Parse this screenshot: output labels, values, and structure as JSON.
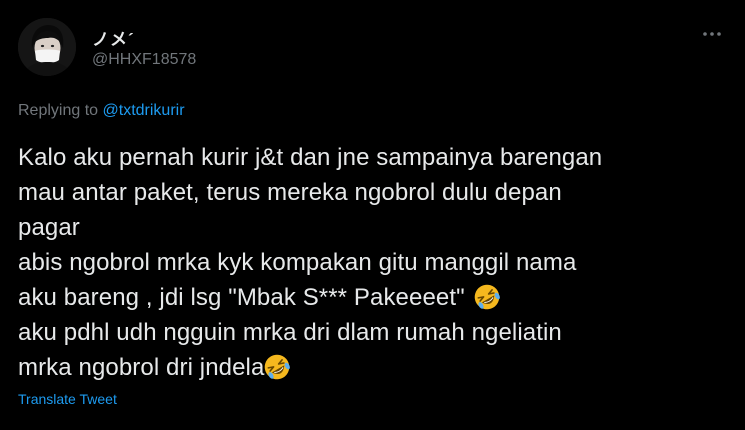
{
  "tweet": {
    "display_name": "ノメ´",
    "handle": "@HHXF18578",
    "more_icon": "more-horizontal-icon",
    "avatar_icon": "user-avatar",
    "replying": {
      "prefix": "Replying to ",
      "mention": "@txtdrikurir"
    },
    "lines": [
      {
        "text": "Kalo aku pernah kurir j&t dan jne sampainya barengan",
        "emoji": ""
      },
      {
        "text": "mau antar paket, terus mereka ngobrol dulu depan",
        "emoji": ""
      },
      {
        "text": "pagar",
        "emoji": ""
      },
      {
        "text": "abis ngobrol mrka kyk kompakan gitu manggil nama",
        "emoji": ""
      },
      {
        "text": "aku bareng , jdi lsg \"Mbak S*** Pakeeeet\" ",
        "emoji": "rolling-on-the-floor-laughing"
      },
      {
        "text": "aku pdhl udh ngguin mrka dri dlam rumah ngeliatin",
        "emoji": ""
      },
      {
        "text": "mrka ngobrol dri jndela",
        "emoji": "rolling-on-the-floor-laughing"
      }
    ],
    "translate_label": "Translate Tweet"
  },
  "colors": {
    "background": "#000000",
    "text": "#e7e9ea",
    "secondary": "#71767b",
    "accent": "#1d9bf0",
    "emoji": "#f5b81e"
  }
}
